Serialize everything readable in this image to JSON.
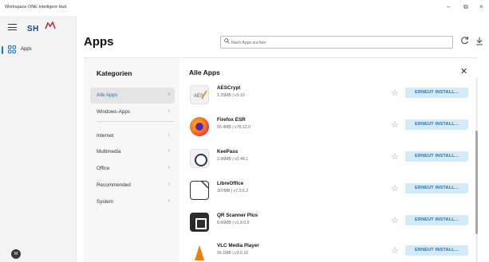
{
  "window": {
    "title": "Workspace ONE Intelligent Hub",
    "controls": {
      "minimize": "–",
      "maximize": "⧉",
      "close": "×"
    }
  },
  "sidebar": {
    "logo_text": "SH",
    "nav": [
      {
        "label": "Apps",
        "icon": "apps-grid-icon",
        "active": true
      }
    ],
    "avatar_initial": "M"
  },
  "header": {
    "title": "Apps",
    "search_placeholder": "Nach Apps suchen"
  },
  "categories": {
    "title": "Kategorien",
    "items": [
      {
        "label": "Alle Apps",
        "selected": true
      },
      {
        "label": "Windows-Apps",
        "selected": false
      },
      {
        "label": "Internet",
        "selected": false
      },
      {
        "label": "Multimedia",
        "selected": false
      },
      {
        "label": "Office",
        "selected": false
      },
      {
        "label": "Recommended",
        "selected": false
      },
      {
        "label": "System",
        "selected": false
      }
    ]
  },
  "app_list": {
    "title": "Alle Apps",
    "action_label": "ERNEUT INSTALL...",
    "apps": [
      {
        "name": "AESCrypt",
        "meta": "1.25MB | v3.10",
        "icon": "aescrypt-icon"
      },
      {
        "name": "Firefox ESR",
        "meta": "55.4MB | v78.12.0",
        "icon": "firefox-icon"
      },
      {
        "name": "KeePass",
        "meta": "3.96MB | v2.48.1",
        "icon": "keepass-icon"
      },
      {
        "name": "LibreOffice",
        "meta": "307MB | v7.0.6.2",
        "icon": "libreoffice-icon"
      },
      {
        "name": "QR Scanner Plus",
        "meta": "8.66MB | v1.8.0.0",
        "icon": "qr-scanner-icon"
      },
      {
        "name": "VLC Media Player",
        "meta": "56.1MB | v3.0.16",
        "icon": "vlc-icon"
      }
    ]
  },
  "colors": {
    "accent": "#1a73c8",
    "button_bg": "#d5eaf7",
    "button_text": "#2472b5",
    "logo_blue": "#1d3f8f",
    "logo_red": "#c0304a"
  }
}
